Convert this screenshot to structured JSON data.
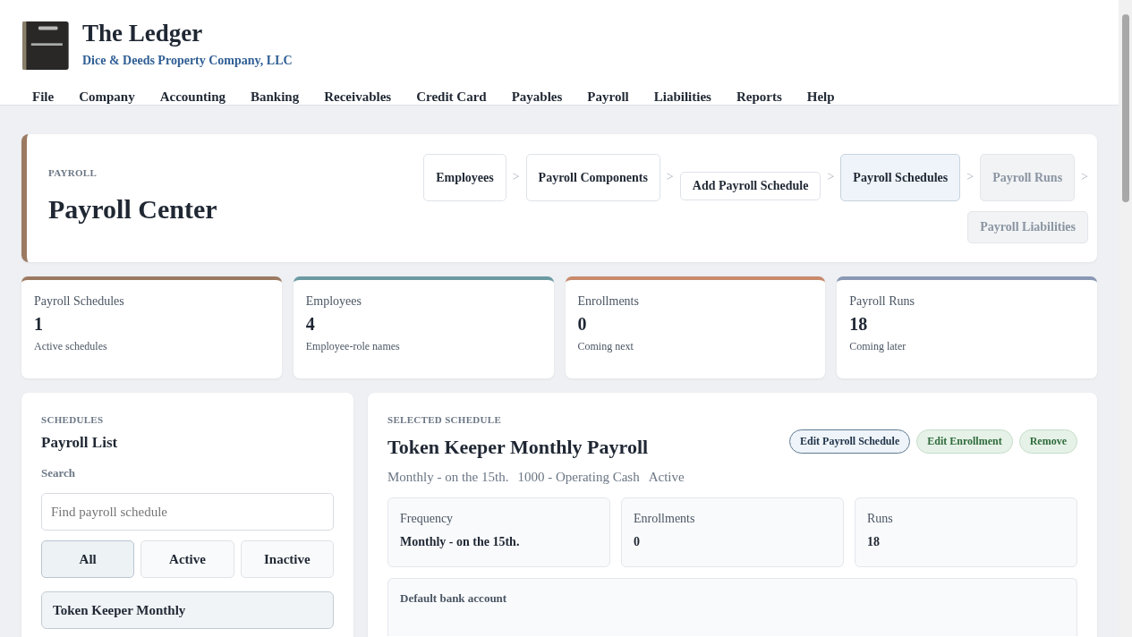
{
  "app": {
    "title": "The Ledger",
    "company": "Dice & Deeds Property Company, LLC"
  },
  "menu": [
    "File",
    "Company",
    "Accounting",
    "Banking",
    "Receivables",
    "Credit Card",
    "Payables",
    "Payroll",
    "Liabilities",
    "Reports",
    "Help"
  ],
  "hero": {
    "eyebrow": "PAYROLL",
    "title": "Payroll Center",
    "steps": [
      {
        "label": "Employees",
        "selected": false,
        "disabled": false
      },
      {
        "label": "Payroll Components",
        "selected": false,
        "disabled": false
      },
      {
        "label": "Add Payroll Schedule",
        "selected": false,
        "disabled": false
      },
      {
        "label": "Payroll Schedules",
        "selected": true,
        "disabled": false
      },
      {
        "label": "Payroll Runs",
        "selected": false,
        "disabled": true
      },
      {
        "label": "Payroll Liabilities",
        "selected": false,
        "disabled": true
      }
    ],
    "separator": ">"
  },
  "stats": [
    {
      "label": "Payroll Schedules",
      "value": "1",
      "note": "Active schedules",
      "color": "#9c7a62"
    },
    {
      "label": "Employees",
      "value": "4",
      "note": "Employee-role names",
      "color": "#6b9aa3"
    },
    {
      "label": "Enrollments",
      "value": "0",
      "note": "Coming next",
      "color": "#c98a6c"
    },
    {
      "label": "Payroll Runs",
      "value": "18",
      "note": "Coming later",
      "color": "#8a98b5"
    }
  ],
  "schedules": {
    "eyebrow": "SCHEDULES",
    "title": "Payroll List",
    "search_label": "Search",
    "search": {
      "placeholder": "Find payroll schedule"
    },
    "filters": [
      {
        "label": "All",
        "selected": true
      },
      {
        "label": "Active",
        "selected": false
      },
      {
        "label": "Inactive",
        "selected": false
      }
    ],
    "items": [
      {
        "name": "Token Keeper Monthly",
        "selected": true
      }
    ]
  },
  "detail": {
    "eyebrow": "SELECTED SCHEDULE",
    "title": "Token Keeper Monthly Payroll",
    "actions": [
      {
        "label": "Edit Payroll Schedule",
        "kind": "primary"
      },
      {
        "label": "Edit Enrollment",
        "kind": "success"
      },
      {
        "label": "Remove",
        "kind": "success"
      }
    ],
    "meta": [
      "Monthly - on the 15th.",
      "1000 - Operating Cash",
      "Active"
    ],
    "facts": [
      {
        "label": "Frequency",
        "value": "Monthly - on the 15th."
      },
      {
        "label": "Enrollments",
        "value": "0"
      },
      {
        "label": "Runs",
        "value": "18"
      }
    ],
    "bank_label": "Default bank account"
  }
}
